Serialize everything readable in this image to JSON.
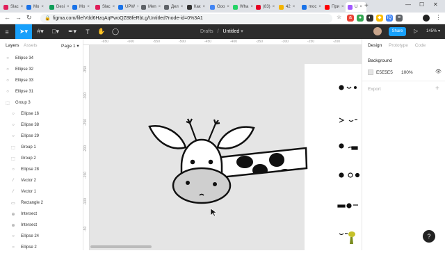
{
  "browser": {
    "tabs": [
      {
        "label": "Slac",
        "color": "#e01e5a"
      },
      {
        "label": "Mo",
        "color": "#1a73e8"
      },
      {
        "label": "Desi",
        "color": "#0f9d58"
      },
      {
        "label": "Mo",
        "color": "#1a73e8"
      },
      {
        "label": "Slac",
        "color": "#e01e5a"
      },
      {
        "label": "UPW",
        "color": "#1a73e8"
      },
      {
        "label": "Men",
        "color": "#5f6368"
      },
      {
        "label": "Дел",
        "color": "#5f6368"
      },
      {
        "label": "Как",
        "color": "#333333"
      },
      {
        "label": "Goo",
        "color": "#4285f4"
      },
      {
        "label": "Wha",
        "color": "#25d366"
      },
      {
        "label": "(83)",
        "color": "#e60023"
      },
      {
        "label": "42",
        "color": "#f4b400"
      },
      {
        "label": "moc",
        "color": "#1a73e8"
      },
      {
        "label": "При",
        "color": "#ff0000"
      },
      {
        "label": "U",
        "color": "#a259ff",
        "active": true
      }
    ],
    "url": "figma.com/file/Vdd6HzqAqPwoQZ88feRbLg/Untitled?node-id=0%3A1",
    "new_tab": "+"
  },
  "toolbar": {
    "crumb_parent": "Drafts",
    "crumb_sep": "/",
    "file_name": "Untitled",
    "share_label": "Share",
    "zoom": "145%"
  },
  "layers_panel": {
    "tab_layers": "Layers",
    "tab_assets": "Assets",
    "page": "Page 1",
    "items": [
      {
        "label": "Ellipse 34",
        "icon": "ellipse",
        "indent": 0
      },
      {
        "label": "Ellipse 32",
        "icon": "ellipse",
        "indent": 0
      },
      {
        "label": "Ellipse 33",
        "icon": "ellipse",
        "indent": 0
      },
      {
        "label": "Ellipse 31",
        "icon": "ellipse",
        "indent": 0
      },
      {
        "label": "Group 3",
        "icon": "group",
        "indent": 0
      },
      {
        "label": "Ellipse 16",
        "icon": "ellipse",
        "indent": 1
      },
      {
        "label": "Ellipse 38",
        "icon": "ellipse",
        "indent": 1
      },
      {
        "label": "Ellipse 29",
        "icon": "ellipse",
        "indent": 1
      },
      {
        "label": "Group 1",
        "icon": "group",
        "indent": 1
      },
      {
        "label": "Group 2",
        "icon": "group",
        "indent": 1
      },
      {
        "label": "Ellipse 28",
        "icon": "ellipse",
        "indent": 1
      },
      {
        "label": "Vector 2",
        "icon": "vector",
        "indent": 1
      },
      {
        "label": "Vector 1",
        "icon": "vector",
        "indent": 1
      },
      {
        "label": "Rectangle 2",
        "icon": "rect",
        "indent": 1
      },
      {
        "label": "Intersect",
        "icon": "bool",
        "indent": 1
      },
      {
        "label": "Intersect",
        "icon": "bool",
        "indent": 1
      },
      {
        "label": "Ellipse 24",
        "icon": "ellipse",
        "indent": 1
      },
      {
        "label": "Ellipse 2",
        "icon": "ellipse",
        "indent": 1
      }
    ]
  },
  "rulers": {
    "top": [
      "-650",
      "-600",
      "-550",
      "-500",
      "-450",
      "-400",
      "-350",
      "-300",
      "-250",
      "-200"
    ],
    "left": [
      "-350",
      "-300",
      "-250",
      "-200",
      "-150",
      "-100",
      "-50"
    ]
  },
  "design_panel": {
    "tab_design": "Design",
    "tab_prototype": "Prototype",
    "tab_code": "Code",
    "background_label": "Background",
    "background_hex": "E5E5E5",
    "background_opacity": "100%",
    "export_label": "Export",
    "export_add": "+"
  },
  "help_label": "?"
}
